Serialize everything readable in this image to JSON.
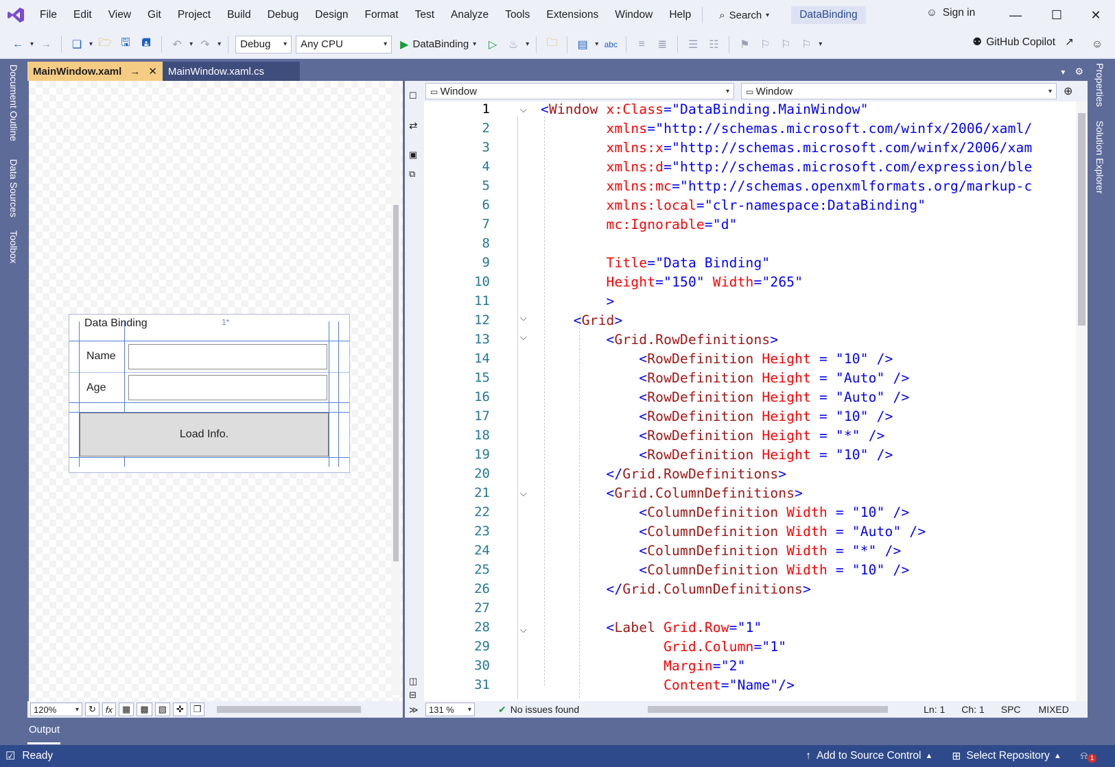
{
  "titlebar": {
    "menu": [
      "File",
      "Edit",
      "View",
      "Git",
      "Project",
      "Build",
      "Debug",
      "Design",
      "Format",
      "Test",
      "Analyze",
      "Tools",
      "Extensions",
      "Window",
      "Help"
    ],
    "search_label": "Search",
    "solution_name": "DataBinding",
    "sign_in": "Sign in"
  },
  "toolbar": {
    "configuration": "Debug",
    "platform": "Any CPU",
    "run_target": "DataBinding",
    "copilot": "GitHub Copilot"
  },
  "left_rail": [
    "Document Outline",
    "Data Sources",
    "Toolbox"
  ],
  "right_rail": [
    "Properties",
    "Solution Explorer"
  ],
  "tabs": [
    {
      "label": "MainWindow.xaml",
      "active": true
    },
    {
      "label": "MainWindow.xaml.cs",
      "active": false
    }
  ],
  "designer": {
    "window_title": "Data Binding",
    "star_marker": "1*",
    "name_label": "Name",
    "age_label": "Age",
    "button_label": "Load Info.",
    "zoom": "120%"
  },
  "code_nav": {
    "left": "Window",
    "right": "Window"
  },
  "code": {
    "line_numbers": [
      "1",
      "2",
      "3",
      "4",
      "5",
      "6",
      "7",
      "8",
      "9",
      "10",
      "11",
      "12",
      "13",
      "14",
      "15",
      "16",
      "17",
      "18",
      "19",
      "20",
      "21",
      "22",
      "23",
      "24",
      "25",
      "26",
      "27",
      "28",
      "29",
      "30",
      "31"
    ],
    "current_line": "1"
  },
  "editor_status": {
    "zoom": "131 %",
    "issues": "No issues found",
    "line": "Ln: 1",
    "col": "Ch: 1",
    "spc": "SPC",
    "eol": "MIXED"
  },
  "output_label": "Output",
  "statusbar": {
    "ready": "Ready",
    "source_control": "Add to Source Control",
    "repository": "Select Repository",
    "notifications": "1"
  },
  "colors": {
    "accent": "#5d6b99",
    "statusbar": "#2f4a8a",
    "active_tab": "#f5cc84"
  }
}
